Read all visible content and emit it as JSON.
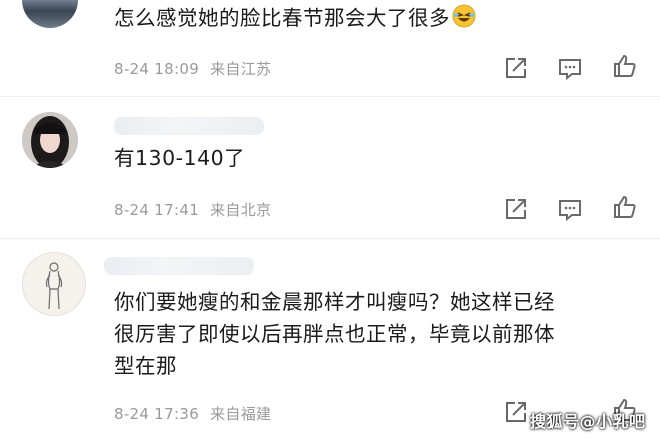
{
  "comments": [
    {
      "text": "怎么感觉她的脸比春节那会大了很多",
      "emoji": "laughing-tears-emoji",
      "date": "8-24 18:09",
      "location": "来自江苏"
    },
    {
      "text": "有130-140了",
      "date": "8-24 17:41",
      "location": "来自北京"
    },
    {
      "text_lines": [
        "你们要她瘦的和金晨那样才叫瘦吗？她这样已经",
        "很厉害了即使以后再胖点也正常，毕竟以前那体",
        "型在那"
      ],
      "date": "8-24 17:36",
      "location": "来自福建"
    }
  ],
  "icons": [
    "share-icon",
    "comment-icon",
    "like-icon"
  ],
  "watermark": "搜狐号@小乳吧"
}
